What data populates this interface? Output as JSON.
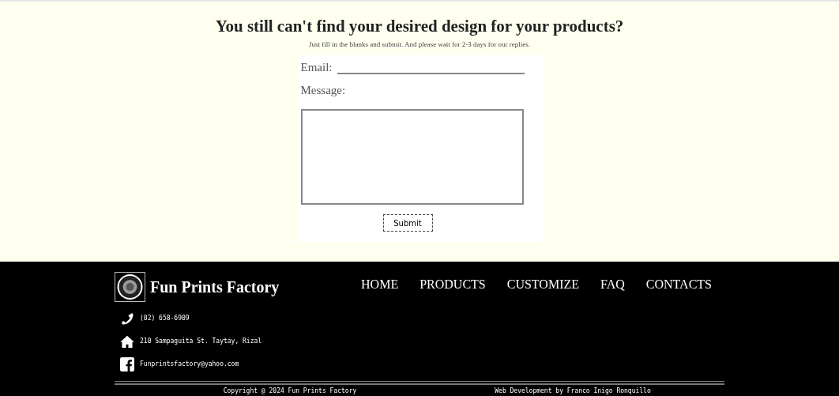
{
  "form_section": {
    "heading": "You still can't find your desired design for your products?",
    "subheading": "Just fill in the blanks and submit. And please wait for 2-3 days for our replies.",
    "email_label": "Email:",
    "message_label": "Message:",
    "submit": "Submit"
  },
  "footer": {
    "brand": "Fun Prints Factory",
    "nav": [
      "HOME",
      "PRODUCTS",
      "CUSTOMIZE",
      "FAQ",
      "CONTACTS"
    ],
    "contacts": [
      {
        "kind": "phone",
        "text": "(02) 658-6909"
      },
      {
        "kind": "address",
        "text": "210 Sampaguita St. Taytay, Rizal"
      },
      {
        "kind": "facebook",
        "text": "Funprintsfactory@yahoo.com"
      }
    ],
    "copyright": "Copyright @ 2024 Fun Prints Factory",
    "credit": "Web Development by Franco Inigo Ronquillo"
  }
}
